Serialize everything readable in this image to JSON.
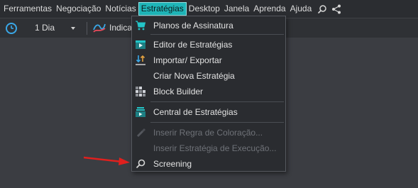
{
  "menubar": {
    "items": [
      {
        "label": "Ferramentas"
      },
      {
        "label": "Negociação"
      },
      {
        "label": "Notícias"
      },
      {
        "label": "Estratégias"
      },
      {
        "label": "Desktop"
      },
      {
        "label": "Janela"
      },
      {
        "label": "Aprenda"
      },
      {
        "label": "Ajuda"
      }
    ],
    "active_index": 3,
    "icons": [
      "search-icon",
      "share-icon"
    ]
  },
  "toolbar": {
    "period": "1 Dia",
    "indicators_label": "Indicad"
  },
  "dropdown": {
    "items": [
      {
        "label": "Planos de Assinatura",
        "icon": "cart-icon",
        "disabled": false
      },
      {
        "label": "Editor de Estratégias",
        "icon": "play-editor-icon",
        "disabled": false
      },
      {
        "label": "Importar/ Exportar",
        "icon": "import-export-icon",
        "disabled": false
      },
      {
        "label": "Criar Nova Estratégia",
        "icon": "",
        "disabled": false
      },
      {
        "label": "Block Builder",
        "icon": "blocks-icon",
        "disabled": false
      },
      {
        "label": "Central de Estratégias",
        "icon": "strategy-center-icon",
        "disabled": false
      },
      {
        "label": "Inserir Regra de Coloração...",
        "icon": "paint-icon",
        "disabled": true
      },
      {
        "label": "Inserir Estratégia de Execução...",
        "icon": "",
        "disabled": true
      },
      {
        "label": "Screening",
        "icon": "search-icon",
        "disabled": false
      }
    ]
  },
  "colors": {
    "accent": "#1fb5b8",
    "arrow": "#e0201e",
    "menubar_bg": "#2b2d31",
    "content_bg": "#3b3d42"
  }
}
